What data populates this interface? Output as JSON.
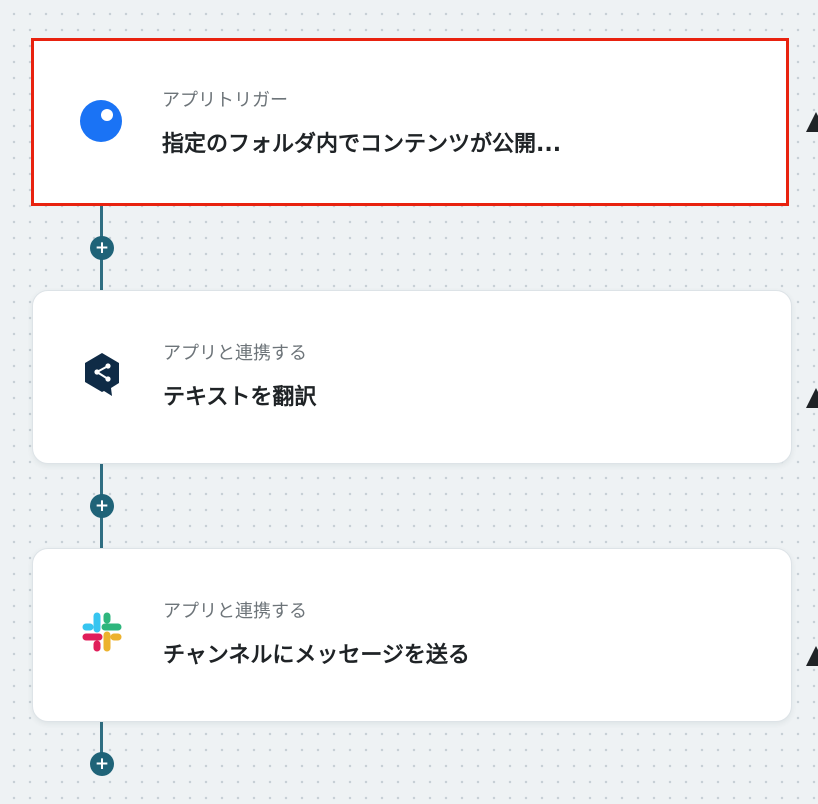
{
  "steps": [
    {
      "subtitle": "アプリトリガー",
      "title": "指定のフォルダ内でコンテンツが公開...",
      "icon": "blue-circle-app-icon",
      "selected": true
    },
    {
      "subtitle": "アプリと連携する",
      "title": "テキストを翻訳",
      "icon": "deepl-icon",
      "selected": false
    },
    {
      "subtitle": "アプリと連携する",
      "title": "チャンネルにメッセージを送る",
      "icon": "slack-icon",
      "selected": false
    }
  ],
  "add_step_label": "+",
  "colors": {
    "selection_border": "#e8220f",
    "connector": "#2f6e82",
    "plus_button": "#1f6378",
    "trigger_icon": "#1a73f5",
    "deepl_icon": "#0f2b46"
  }
}
